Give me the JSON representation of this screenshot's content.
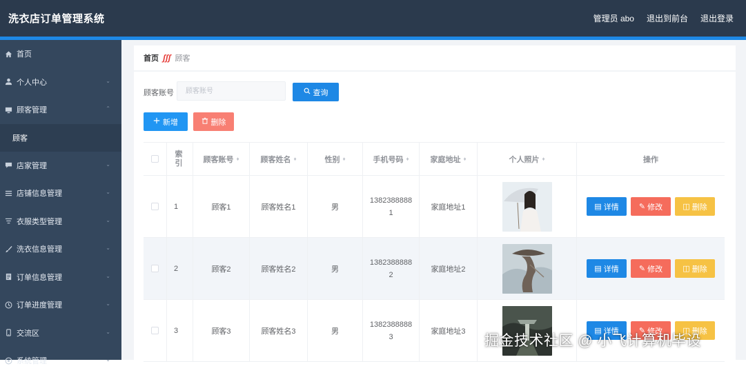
{
  "app": {
    "title": "洗衣店订单管理系统"
  },
  "header": {
    "user": "管理员 abo",
    "to_front": "退出到前台",
    "logout": "退出登录"
  },
  "sidebar": {
    "items": [
      {
        "label": "首页",
        "icon": "home-icon"
      },
      {
        "label": "个人中心",
        "icon": "user-icon"
      },
      {
        "label": "顾客管理",
        "icon": "monitor-icon",
        "expanded": true
      },
      {
        "label": "店家管理",
        "icon": "chat-icon"
      },
      {
        "label": "店铺信息管理",
        "icon": "list-icon"
      },
      {
        "label": "衣服类型管理",
        "icon": "filter-icon"
      },
      {
        "label": "洗衣信息管理",
        "icon": "brush-icon"
      },
      {
        "label": "订单信息管理",
        "icon": "document-icon"
      },
      {
        "label": "订单进度管理",
        "icon": "progress-icon"
      },
      {
        "label": "交流区",
        "icon": "phone-icon"
      },
      {
        "label": "系统管理",
        "icon": "settings-icon"
      }
    ],
    "submenu": {
      "label": "顾客"
    }
  },
  "breadcrumb": {
    "home": "首页",
    "separator": "ʃʃʃ",
    "current": "顾客"
  },
  "search": {
    "label": "顾客账号",
    "placeholder": "顾客账号",
    "value": "",
    "query_label": "查询"
  },
  "toolbar": {
    "add_label": "新增",
    "delete_label": "删除"
  },
  "table": {
    "columns": [
      "索引",
      "顾客账号",
      "顾客姓名",
      "性别",
      "手机号码",
      "家庭地址",
      "个人照片",
      "操作"
    ],
    "rows": [
      {
        "index": "1",
        "account": "顾客1",
        "name": "顾客姓名1",
        "sex": "男",
        "phone": "13823888881",
        "address": "家庭地址1"
      },
      {
        "index": "2",
        "account": "顾客2",
        "name": "顾客姓名2",
        "sex": "男",
        "phone": "13823888882",
        "address": "家庭地址2"
      },
      {
        "index": "3",
        "account": "顾客3",
        "name": "顾客姓名3",
        "sex": "男",
        "phone": "13823888883",
        "address": "家庭地址3"
      }
    ],
    "actions": {
      "detail": "详情",
      "edit": "修改",
      "remove": "删除"
    }
  },
  "watermark": "掘金技术社区 @ 小飞计算机毕设",
  "colors": {
    "topbar": "#2b3a4d",
    "sidebar": "#34475d",
    "accent": "#1e88e5",
    "primary": "#1e88e5",
    "danger": "#f56c5c",
    "warning": "#f6c244"
  }
}
